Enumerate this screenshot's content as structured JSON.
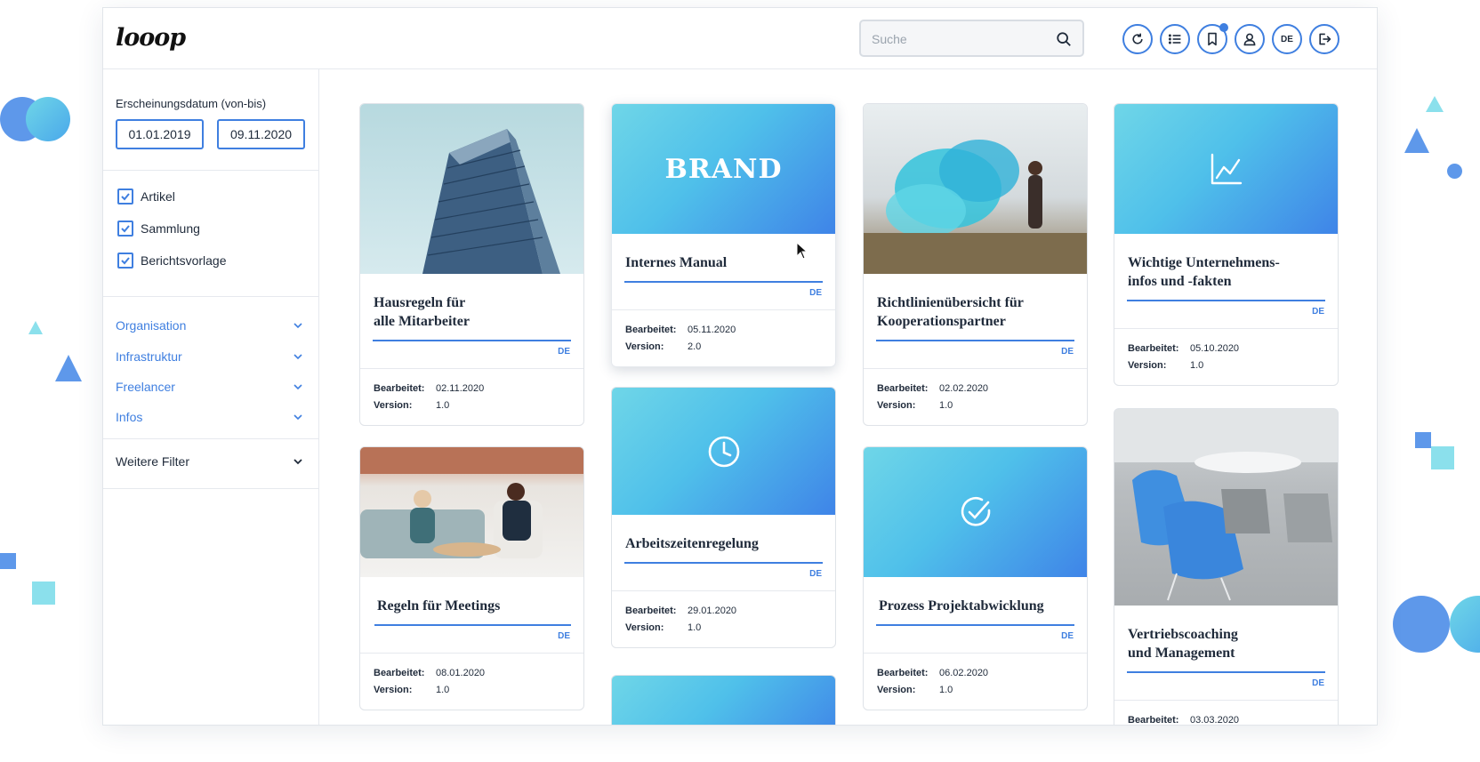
{
  "app": {
    "logo": "looop"
  },
  "header": {
    "search": {
      "placeholder": "Suche"
    },
    "language_button": "DE",
    "icons": [
      "refresh-icon",
      "list-icon",
      "bookmark-icon",
      "user-icon",
      "language-button",
      "logout-icon"
    ]
  },
  "colors": {
    "accent": "#3f7fe0",
    "gradient_start": "#6fd6e8",
    "gradient_end": "#3f84e8"
  },
  "sidebar": {
    "date_filter": {
      "label": "Erscheinungsdatum (von-bis)",
      "from": "01.01.2019",
      "to": "09.11.2020"
    },
    "types": [
      {
        "label": "Artikel",
        "checked": true
      },
      {
        "label": "Sammlung",
        "checked": true
      },
      {
        "label": "Berichtsvorlage",
        "checked": true
      }
    ],
    "categories": [
      {
        "label": "Organisation"
      },
      {
        "label": "Infrastruktur"
      },
      {
        "label": "Freelancer"
      },
      {
        "label": "Infos"
      }
    ],
    "more_filters": "Weitere Filter"
  },
  "cards": [
    {
      "title": "Hausregeln für alle Mitarbeiter",
      "title_lines": [
        "Hausregeln für",
        "alle Mitarbeiter"
      ],
      "lang": "DE",
      "edited_label": "Bearbeitet:",
      "edited": "02.11.2020",
      "version_label": "Version:",
      "version": "1.0",
      "media": "building-photo"
    },
    {
      "title": "Regeln für Meetings",
      "title_lines": [
        "Regeln für Meetings"
      ],
      "lang": "DE",
      "edited_label": "Bearbeitet:",
      "edited": "08.01.2020",
      "version_label": "Version:",
      "version": "1.0",
      "media": "meeting-photo"
    },
    {
      "title": "Internes Manual",
      "title_lines": [
        "Internes Manual"
      ],
      "lang": "DE",
      "edited_label": "Bearbeitet:",
      "edited": "05.11.2020",
      "version_label": "Version:",
      "version": "2.0",
      "media": "brand",
      "media_text": "BRAND"
    },
    {
      "title": "Arbeitszeitenregelung",
      "title_lines": [
        "Arbeitszeitenregelung"
      ],
      "lang": "DE",
      "edited_label": "Bearbeitet:",
      "edited": "29.01.2020",
      "version_label": "Version:",
      "version": "1.0",
      "media": "clock-icon"
    },
    {
      "title": "Richtlinienübersicht für Kooperationspartner",
      "title_lines": [
        "Richtlinienübersicht für",
        "Kooperationspartner"
      ],
      "lang": "DE",
      "edited_label": "Bearbeitet:",
      "edited": "02.02.2020",
      "version_label": "Version:",
      "version": "1.0",
      "media": "smoke-photo"
    },
    {
      "title": "Prozess Projektabwicklung",
      "title_lines": [
        "Prozess Projektabwicklung"
      ],
      "lang": "DE",
      "edited_label": "Bearbeitet:",
      "edited": "06.02.2020",
      "version_label": "Version:",
      "version": "1.0",
      "media": "check-icon"
    },
    {
      "title": "Wichtige Unternehmensinfos und -fakten",
      "title_lines": [
        "Wichtige Unternehmens-",
        "infos und -fakten"
      ],
      "lang": "DE",
      "edited_label": "Bearbeitet:",
      "edited": "05.10.2020",
      "version_label": "Version:",
      "version": "1.0",
      "media": "chart-icon"
    },
    {
      "title": "Vertriebscoaching und Management",
      "title_lines": [
        "Vertriebscoaching",
        "und Management"
      ],
      "lang": "DE",
      "edited_label": "Bearbeitet:",
      "edited": "03.03.2020",
      "media": "chairs-photo"
    }
  ]
}
